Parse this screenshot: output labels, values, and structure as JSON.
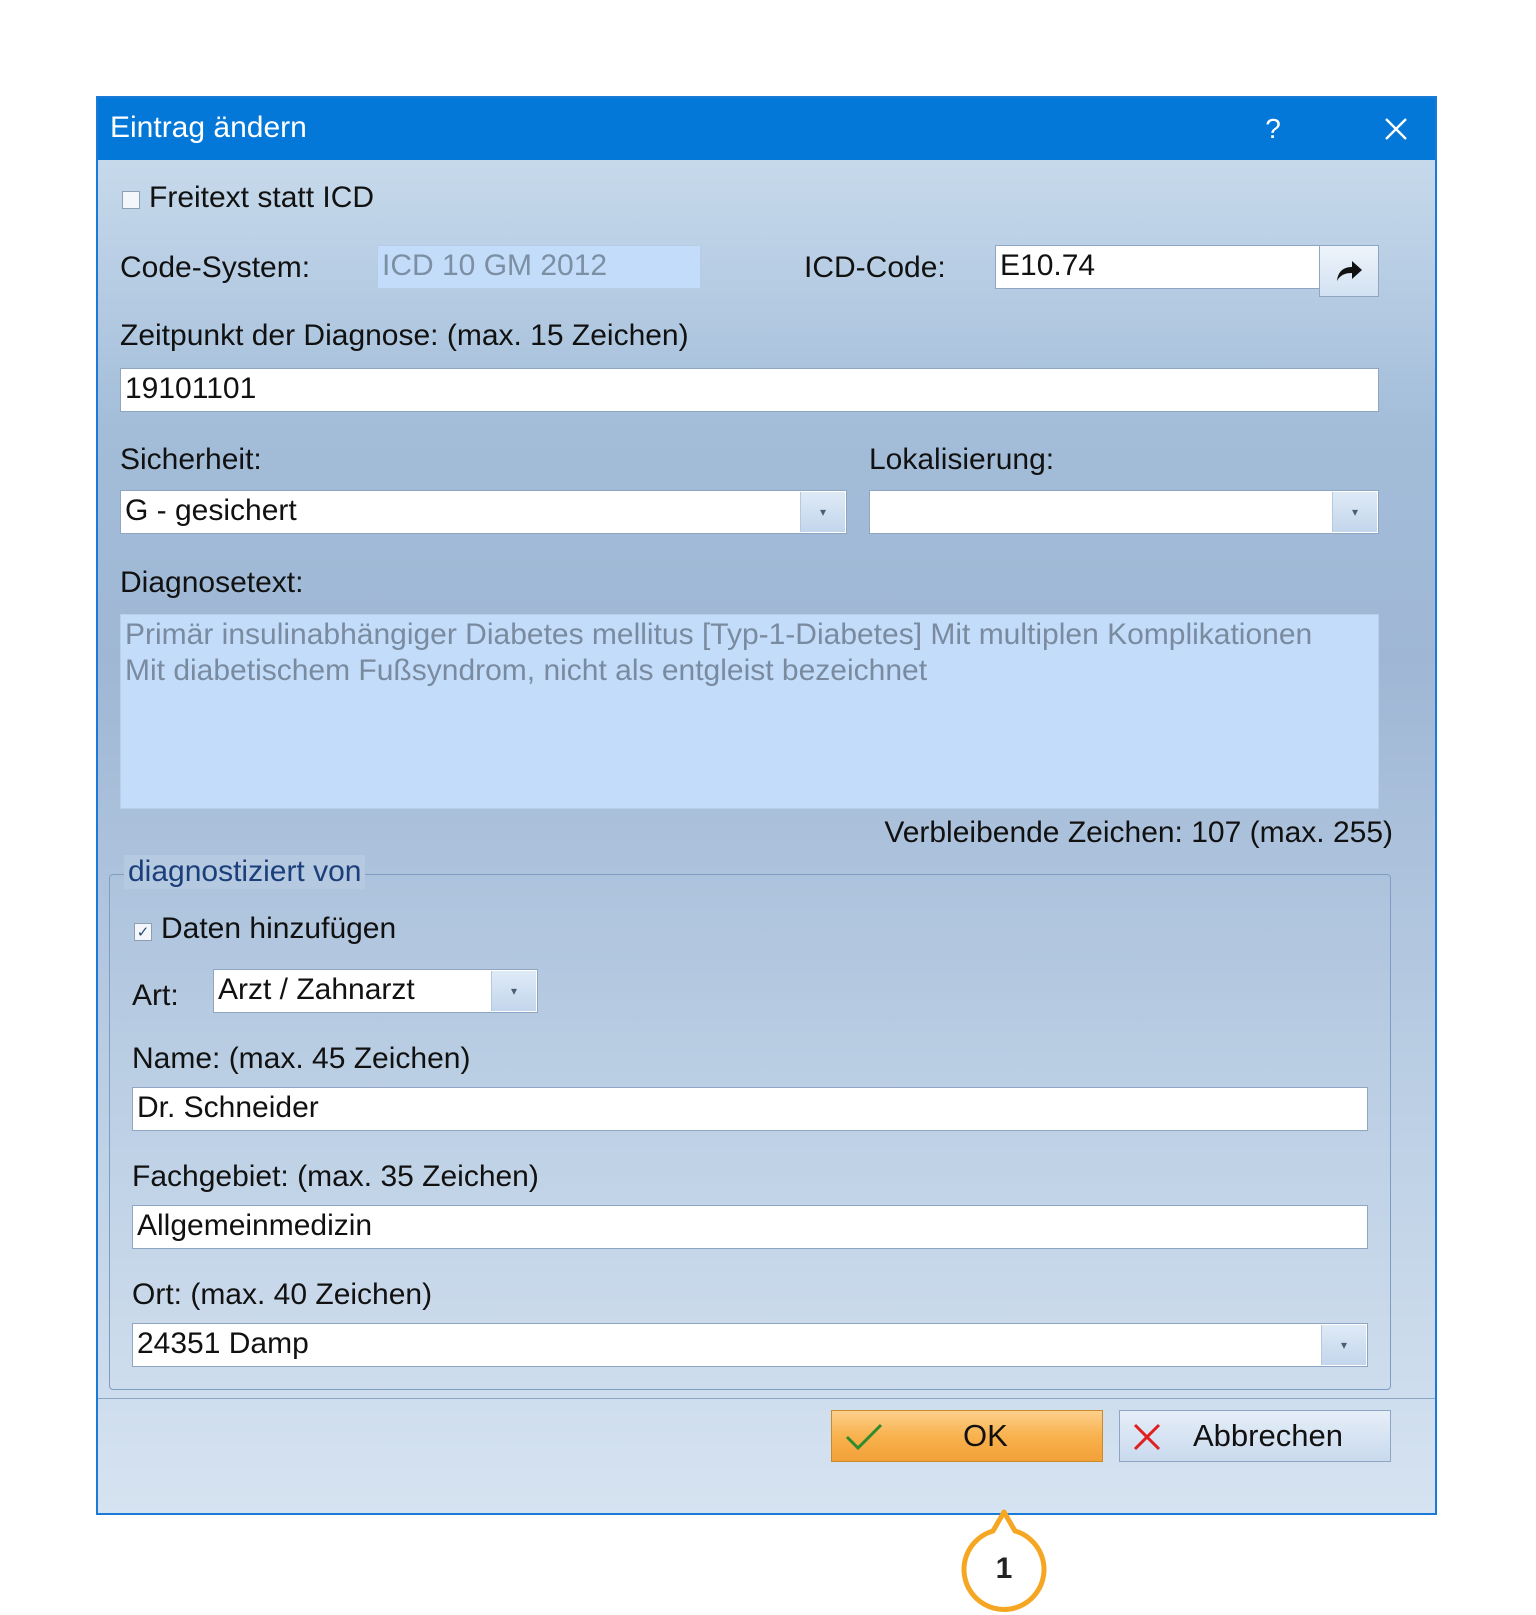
{
  "dialog": {
    "title": "Eintrag ändern",
    "help_label": "?",
    "freetext_checkbox": {
      "label": "Freitext statt ICD",
      "checked": false
    },
    "code_system": {
      "label": "Code-System:",
      "value": "ICD 10 GM 2012"
    },
    "icd_code": {
      "label": "ICD-Code:",
      "value": "E10.74"
    },
    "diagnosis_time": {
      "label": "Zeitpunkt der Diagnose: (max. 15 Zeichen)",
      "value": "19101101"
    },
    "certainty": {
      "label": "Sicherheit:",
      "value": "G - gesichert"
    },
    "localization": {
      "label": "Lokalisierung:",
      "value": ""
    },
    "diagnosis_text": {
      "label": "Diagnosetext:",
      "line1": "Primär insulinabhängiger Diabetes mellitus [Typ-1-Diabetes] Mit multiplen Komplikationen",
      "line2": "Mit diabetischem Fußsyndrom, nicht als entgleist bezeichnet"
    },
    "remaining_chars": "Verbleibende Zeichen: 107 (max. 255)",
    "diagnosed_by": {
      "legend": "diagnostiziert von",
      "add_data_checkbox": {
        "label": "Daten hinzufügen",
        "checked": true
      },
      "type": {
        "label": "Art:",
        "value": "Arzt / Zahnarzt"
      },
      "name": {
        "label": "Name: (max. 45 Zeichen)",
        "value": "Dr. Schneider"
      },
      "specialty": {
        "label": "Fachgebiet: (max. 35 Zeichen)",
        "value": "Allgemeinmedizin"
      },
      "location": {
        "label": "Ort: (max. 40 Zeichen)",
        "value": "24351 Damp"
      }
    },
    "buttons": {
      "ok": "OK",
      "cancel": "Abbrechen"
    }
  },
  "callout": {
    "number": "1"
  },
  "colors": {
    "titlebar": "#0378d8",
    "ok_button": "#f8b24e",
    "callout": "#f5a623"
  }
}
